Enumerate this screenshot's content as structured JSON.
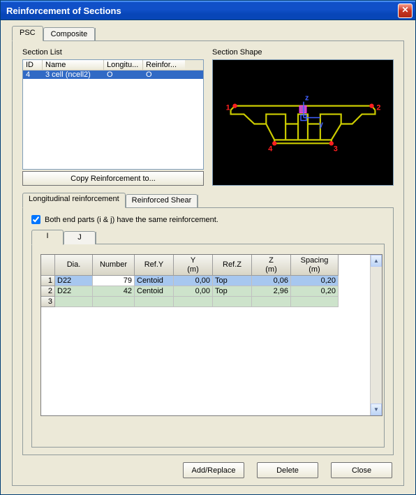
{
  "window": {
    "title": "Reinforcement of Sections"
  },
  "tabs": {
    "psc": "PSC",
    "composite": "Composite"
  },
  "section_list": {
    "label": "Section List",
    "headers": {
      "id": "ID",
      "name": "Name",
      "longitu": "Longitu...",
      "reinfor": "Reinfor..."
    },
    "rows": [
      {
        "id": "4",
        "name": "3 cell (ncell2)",
        "longitu": "O",
        "reinfor": "O"
      }
    ],
    "copy_btn": "Copy Reinforcement to..."
  },
  "section_shape": {
    "label": "Section Shape",
    "points": {
      "p1": "1",
      "p2": "2",
      "p3": "3",
      "p4": "4"
    },
    "axes": {
      "y": "y",
      "z": "z"
    }
  },
  "inner_tabs": {
    "long": "Longitudinal reinforcement",
    "shear": "Reinforced Shear"
  },
  "same_reinforcement": {
    "checked": true,
    "label": "Both end parts (i & j) have the same reinforcement."
  },
  "ij_tabs": {
    "i": "I",
    "j": "J"
  },
  "rebar_grid": {
    "headers": {
      "dia": "Dia.",
      "number": "Number",
      "refy": "Ref.Y",
      "ym": "Y\n(m)",
      "refz": "Ref.Z",
      "zm": "Z\n(m)",
      "spacing": "Spacing\n(m)"
    },
    "rows": [
      {
        "n": "1",
        "dia": "D22",
        "number": "79",
        "refy": "Centoid",
        "ym": "0,00",
        "refz": "Top",
        "zm": "0,06",
        "spacing": "0,20"
      },
      {
        "n": "2",
        "dia": "D22",
        "number": "42",
        "refy": "Centoid",
        "ym": "0,00",
        "refz": "Top",
        "zm": "2,96",
        "spacing": "0,20"
      },
      {
        "n": "3",
        "dia": "",
        "number": "",
        "refy": "",
        "ym": "",
        "refz": "",
        "zm": "",
        "spacing": ""
      }
    ]
  },
  "footer": {
    "add_replace": "Add/Replace",
    "delete": "Delete",
    "close": "Close"
  }
}
